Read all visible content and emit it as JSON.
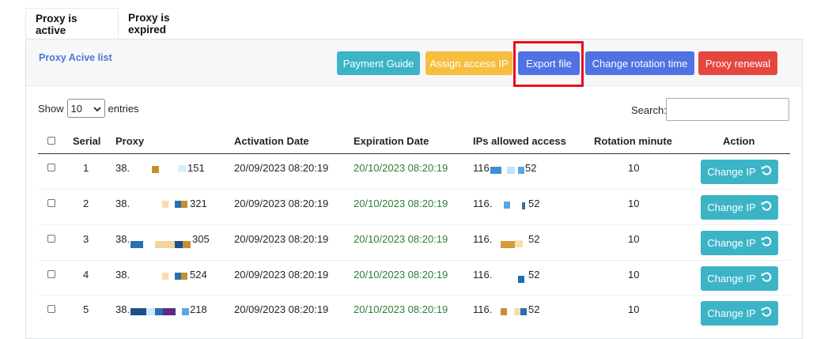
{
  "tabs": [
    {
      "label": "Proxy is active",
      "active": true
    },
    {
      "label": "Proxy is expired",
      "active": false
    }
  ],
  "card": {
    "title": "Proxy Acive list",
    "buttons": [
      {
        "label": "Payment Guide",
        "color": "#3bb4c6"
      },
      {
        "label": "Assign access IP",
        "color": "#f5be3e"
      },
      {
        "label": "Export file",
        "color": "#4f73e2"
      },
      {
        "label": "Change rotation time",
        "color": "#4f73e2"
      },
      {
        "label": "Proxy renewal",
        "color": "#e5473f"
      }
    ]
  },
  "controls": {
    "show_label": "Show",
    "entries_value": "10",
    "entries_label": "entries",
    "search_label": "Search:",
    "search_value": ""
  },
  "table": {
    "headers": [
      "Serial",
      "Proxy",
      "Activation Date",
      "Expiration Date",
      "IPs allowed access",
      "Rotation minute",
      "Action"
    ],
    "rows": [
      {
        "serial": "1",
        "proxy_start": "38.",
        "proxy_end": "151",
        "activation": "20/09/2023 08:20:19",
        "expiration": "20/10/2023 08:20:19",
        "ip_start": "116.",
        "ip_end": "52",
        "rotation": "10",
        "action": "Change IP"
      },
      {
        "serial": "2",
        "proxy_start": "38.",
        "proxy_end": "321",
        "activation": "20/09/2023 08:20:19",
        "expiration": "20/10/2023 08:20:19",
        "ip_start": "116.",
        "ip_end": "52",
        "rotation": "10",
        "action": "Change IP"
      },
      {
        "serial": "3",
        "proxy_start": "38.",
        "proxy_end": "305",
        "activation": "20/09/2023 08:20:19",
        "expiration": "20/10/2023 08:20:19",
        "ip_start": "116.",
        "ip_end": "52",
        "rotation": "10",
        "action": "Change IP"
      },
      {
        "serial": "4",
        "proxy_start": "38.",
        "proxy_end": "524",
        "activation": "20/09/2023 08:20:19",
        "expiration": "20/10/2023 08:20:19",
        "ip_start": "116.",
        "ip_end": "52",
        "rotation": "10",
        "action": "Change IP"
      },
      {
        "serial": "5",
        "proxy_start": "38.",
        "proxy_end": "218",
        "activation": "20/09/2023 08:20:19",
        "expiration": "20/10/2023 08:20:19",
        "ip_start": "116.",
        "ip_end": "52",
        "rotation": "10",
        "action": "Change IP"
      }
    ]
  },
  "colors": {
    "accent": "#4f73e2",
    "highlight": "#e5121c",
    "expiration_text": "#2e7d32",
    "action_button": "#3bb4c6"
  }
}
